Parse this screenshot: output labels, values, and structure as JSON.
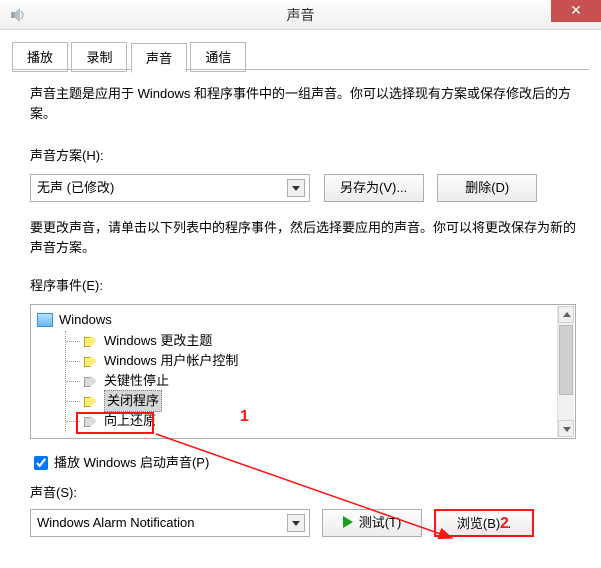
{
  "window": {
    "title": "声音",
    "close_glyph": "✕"
  },
  "tabs": [
    "播放",
    "录制",
    "声音",
    "通信"
  ],
  "active_tab_index": 2,
  "para1": "声音主题是应用于 Windows 和程序事件中的一组声音。你可以选择现有方案或保存修改后的方案。",
  "scheme": {
    "label": "声音方案(H):",
    "value": "无声 (已修改)",
    "save_as": "另存为(V)...",
    "delete": "删除(D)"
  },
  "para2": "要更改声音，请单击以下列表中的程序事件，然后选择要应用的声音。你可以将更改保存为新的声音方案。",
  "events": {
    "label": "程序事件(E):",
    "root": "Windows",
    "items": [
      {
        "label": "Windows 更改主题",
        "muted": false
      },
      {
        "label": "Windows 用户帐户控制",
        "muted": false
      },
      {
        "label": "关键性停止",
        "muted": true
      },
      {
        "label": "关闭程序",
        "muted": false,
        "selected": true
      },
      {
        "label": "向上还原",
        "muted": true
      }
    ]
  },
  "play_startup": {
    "label": "播放 Windows 启动声音(P)",
    "checked": true
  },
  "sound": {
    "label": "声音(S):",
    "value": "Windows Alarm Notification",
    "test": "测试(T)",
    "browse": "浏览(B)..."
  },
  "annotations": {
    "marker1": "1",
    "marker2": "2"
  }
}
